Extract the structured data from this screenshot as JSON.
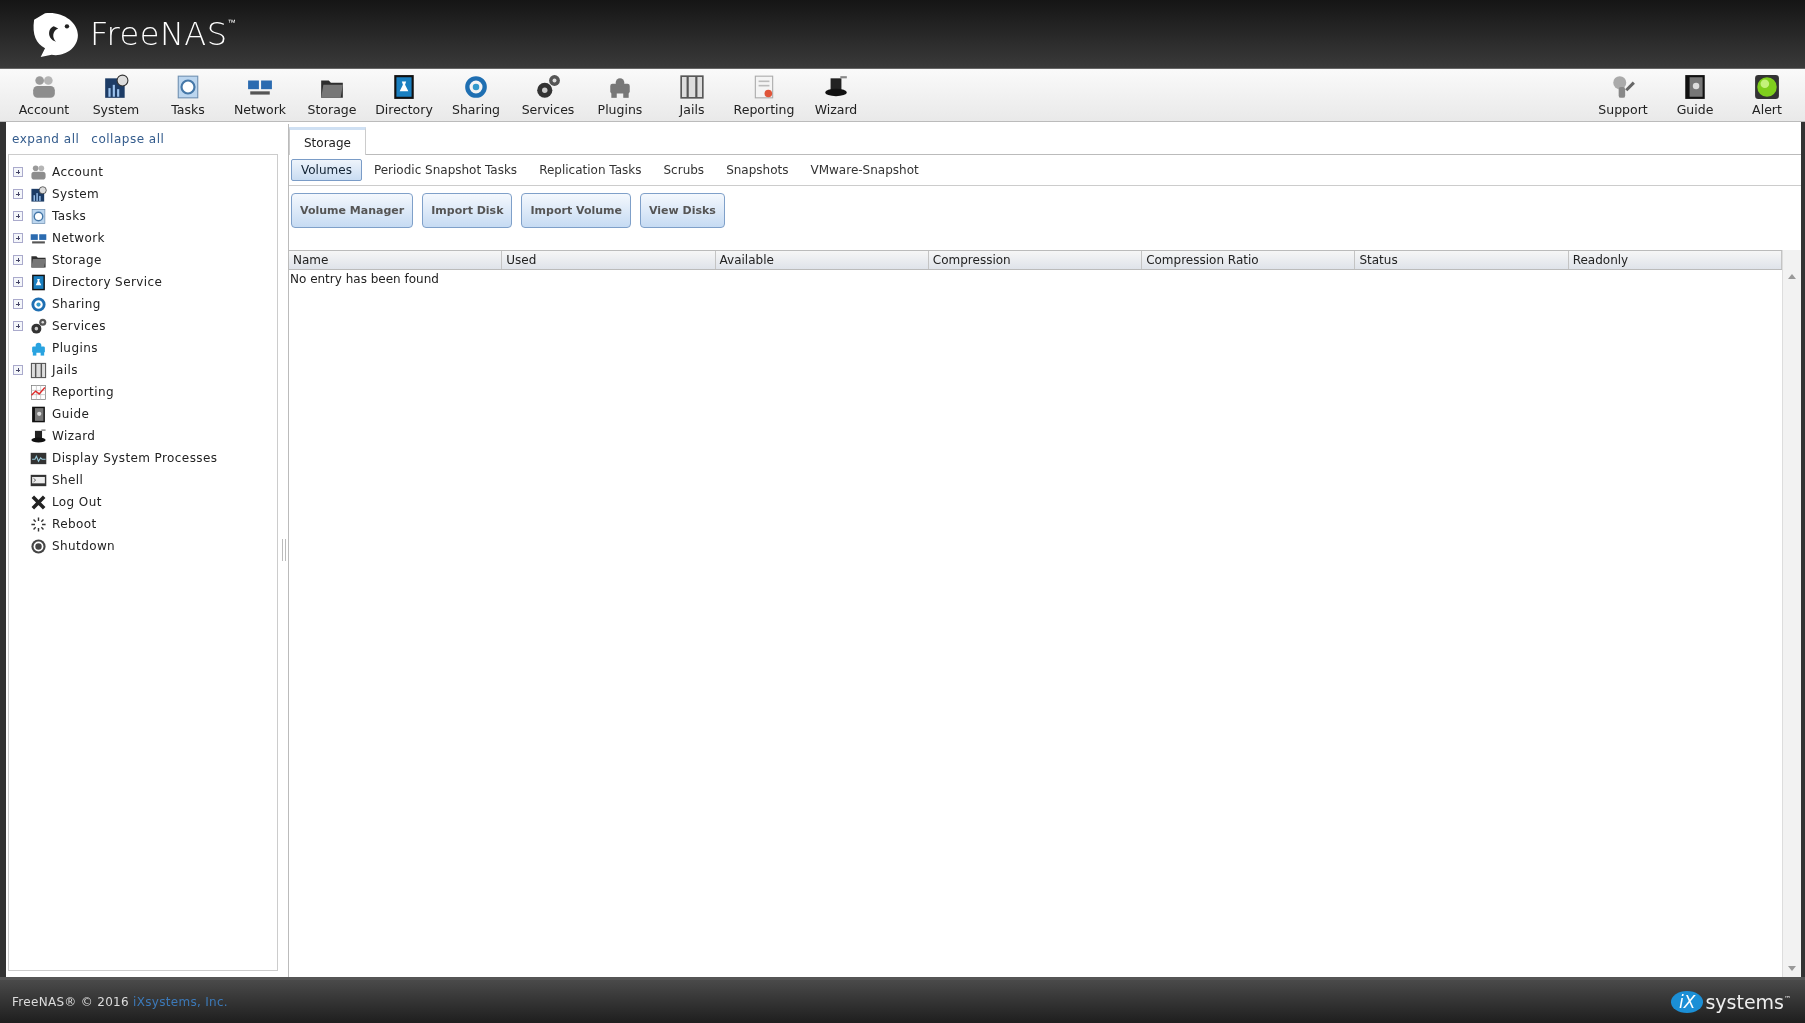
{
  "header": {
    "logo_text": "FreeNAS",
    "trademark": "™"
  },
  "toolbar": {
    "items": [
      {
        "label": "Account"
      },
      {
        "label": "System"
      },
      {
        "label": "Tasks"
      },
      {
        "label": "Network"
      },
      {
        "label": "Storage"
      },
      {
        "label": "Directory"
      },
      {
        "label": "Sharing"
      },
      {
        "label": "Services"
      },
      {
        "label": "Plugins"
      },
      {
        "label": "Jails"
      },
      {
        "label": "Reporting"
      },
      {
        "label": "Wizard"
      }
    ],
    "right_items": [
      {
        "label": "Support"
      },
      {
        "label": "Guide"
      },
      {
        "label": "Alert"
      }
    ]
  },
  "sidebar": {
    "links": [
      "expand all",
      "collapse all"
    ],
    "items": [
      {
        "label": "Account",
        "kind": "branch",
        "expanded": false
      },
      {
        "label": "System",
        "kind": "branch",
        "expanded": false
      },
      {
        "label": "Tasks",
        "kind": "branch",
        "expanded": false
      },
      {
        "label": "Network",
        "kind": "branch",
        "expanded": false
      },
      {
        "label": "Storage",
        "kind": "branch",
        "expanded": false
      },
      {
        "label": "Directory Service",
        "kind": "branch",
        "expanded": false
      },
      {
        "label": "Sharing",
        "kind": "branch",
        "expanded": false
      },
      {
        "label": "Services",
        "kind": "branch",
        "expanded": false
      },
      {
        "label": "Plugins",
        "kind": "leaf"
      },
      {
        "label": "Jails",
        "kind": "branch",
        "expanded": false
      },
      {
        "label": "Reporting",
        "kind": "leaf"
      },
      {
        "label": "Guide",
        "kind": "leaf"
      },
      {
        "label": "Wizard",
        "kind": "leaf"
      },
      {
        "label": "Display System Processes",
        "kind": "leaf"
      },
      {
        "label": "Shell",
        "kind": "leaf"
      },
      {
        "label": "Log Out",
        "kind": "leaf"
      },
      {
        "label": "Reboot",
        "kind": "leaf"
      },
      {
        "label": "Shutdown",
        "kind": "leaf"
      }
    ]
  },
  "tabs": [
    {
      "label": "Storage",
      "selected": true
    }
  ],
  "sub_tabs": [
    {
      "label": "Volumes",
      "selected": true
    },
    {
      "label": "Periodic Snapshot Tasks",
      "selected": false
    },
    {
      "label": "Replication Tasks",
      "selected": false
    },
    {
      "label": "Scrubs",
      "selected": false
    },
    {
      "label": "Snapshots",
      "selected": false
    },
    {
      "label": "VMware-Snapshot",
      "selected": false
    }
  ],
  "buttons": [
    "Volume Manager",
    "Import Disk",
    "Import Volume",
    "View Disks"
  ],
  "table": {
    "columns": [
      "Name",
      "Used",
      "Available",
      "Compression",
      "Compression Ratio",
      "Status",
      "Readonly"
    ],
    "empty_message": "No entry has been found"
  },
  "footer": {
    "copyright": "FreeNAS® © 2016 ",
    "company_link": "iXsystems, Inc.",
    "brand_mark": "iX",
    "brand_text": "systems",
    "brand_trademark": "™"
  }
}
